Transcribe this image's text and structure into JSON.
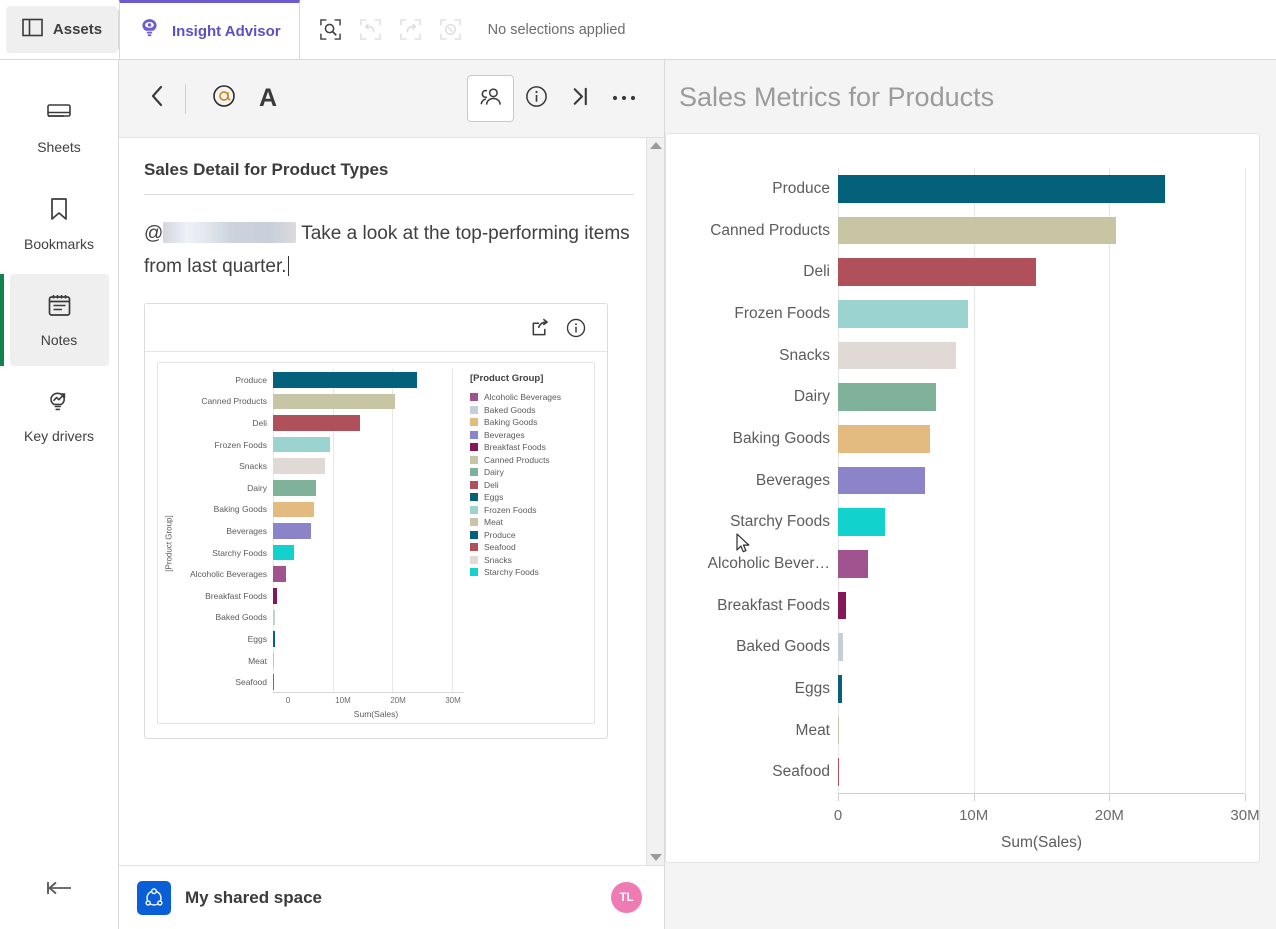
{
  "topbar": {
    "assets_label": "Assets",
    "assets_icon": "panel-layout-icon",
    "insight_advisor_label": "Insight Advisor",
    "insight_advisor_icon": "lightbulb-eye-icon",
    "tools": [
      {
        "name": "selection-search-icon",
        "enabled": true
      },
      {
        "name": "step-back-icon",
        "enabled": false
      },
      {
        "name": "step-forward-icon",
        "enabled": false
      },
      {
        "name": "clear-selections-icon",
        "enabled": false
      }
    ],
    "selections_status": "No selections applied"
  },
  "sidebar": {
    "items": [
      {
        "label": "Sheets",
        "icon": "sheets-icon",
        "active": false
      },
      {
        "label": "Bookmarks",
        "icon": "bookmark-icon",
        "active": false
      },
      {
        "label": "Notes",
        "icon": "notes-icon",
        "active": true
      },
      {
        "label": "Key drivers",
        "icon": "key-drivers-icon",
        "active": false
      }
    ],
    "collapse_icon": "collapse-left-icon",
    "active_indicator_color": "#12834a"
  },
  "notes_panel": {
    "toolbar": {
      "back_icon": "chevron-left-icon",
      "mention_label": "@",
      "format_text_label": "A",
      "collaborators_icon": "people-icon",
      "info_icon": "info-circle-icon",
      "collapse_right_icon": "collapse-right-icon",
      "more_icon": "ellipsis-icon"
    },
    "note_title": "Sales Detail for Product Types",
    "note_body_prefix": "@",
    "note_mention_redacted": true,
    "note_body_text": "Take a look at the top-performing items from last quarter.",
    "embedded_card": {
      "share_icon": "share-export-icon",
      "info_icon": "info-circle-icon"
    },
    "scrollbar": {
      "up_icon": "scroll-up-arrow",
      "down_icon": "scroll-down-arrow"
    }
  },
  "space_bar": {
    "icon": "space-icon",
    "name": "My shared space",
    "avatar_initials": "TL",
    "avatar_color": "#ef7bb4"
  },
  "main": {
    "title": "Sales Metrics for Products"
  },
  "colors": {
    "Produce": "#04617b",
    "Canned Products": "#c7c5a4",
    "Deli": "#b0505b",
    "Frozen Foods": "#9bd3d0",
    "Snacks": "#e1d9d5",
    "Dairy": "#80b29b",
    "Baking Goods": "#e3bb80",
    "Beverages": "#8b84c8",
    "Starchy Foods": "#12d2cd",
    "Alcoholic Beverages": "#a0538f",
    "Breakfast Foods": "#84195a",
    "Baked Goods": "#c5cfd9",
    "Eggs": "#0a6079",
    "Meat": "#c7c5a4",
    "Seafood": "#b0505b"
  },
  "chart_data": [
    {
      "id": "main-chart",
      "type": "bar",
      "orientation": "horizontal",
      "title": "Sales Metrics for Products",
      "xlabel": "Sum(Sales)",
      "ylabel": "",
      "xlim": [
        0,
        30000000
      ],
      "xticks": [
        0,
        10000000,
        20000000,
        30000000
      ],
      "xticklabels": [
        "0",
        "10M",
        "20M",
        "30M"
      ],
      "grid": true,
      "legend": "none",
      "categories": [
        "Produce",
        "Canned Products",
        "Deli",
        "Frozen Foods",
        "Snacks",
        "Dairy",
        "Baking Goods",
        "Beverages",
        "Starchy Foods",
        "Alcoholic Bever…",
        "Breakfast Foods",
        "Baked Goods",
        "Eggs",
        "Meat",
        "Seafood"
      ],
      "values": [
        24100000,
        20500000,
        14600000,
        9600000,
        8700000,
        7200000,
        6800000,
        6400000,
        3500000,
        2200000,
        600000,
        350000,
        300000,
        40000,
        20000
      ]
    },
    {
      "id": "note-embedded-chart",
      "type": "bar",
      "orientation": "horizontal",
      "title": "",
      "xlabel": "Sum(Sales)",
      "ylabel": "[Product Group]",
      "xlim": [
        0,
        32000000
      ],
      "xticks": [
        0,
        10000000,
        20000000,
        30000000
      ],
      "xticklabels": [
        "0",
        "10M",
        "20M",
        "30M"
      ],
      "grid": true,
      "legend_title": "[Product Group]",
      "legend_position": "right",
      "legend_entries": [
        "Alcoholic Beverages",
        "Baked Goods",
        "Baking Goods",
        "Beverages",
        "Breakfast Foods",
        "Canned Products",
        "Dairy",
        "Deli",
        "Eggs",
        "Frozen Foods",
        "Meat",
        "Produce",
        "Seafood",
        "Snacks",
        "Starchy Foods"
      ],
      "categories": [
        "Produce",
        "Canned Products",
        "Deli",
        "Frozen Foods",
        "Snacks",
        "Dairy",
        "Baking Goods",
        "Beverages",
        "Starchy Foods",
        "Alcoholic Beverages",
        "Breakfast Foods",
        "Baked Goods",
        "Eggs",
        "Meat",
        "Seafood"
      ],
      "values": [
        24100000,
        20500000,
        14600000,
        9600000,
        8700000,
        7200000,
        6800000,
        6400000,
        3500000,
        2200000,
        600000,
        350000,
        300000,
        40000,
        20000
      ]
    }
  ]
}
